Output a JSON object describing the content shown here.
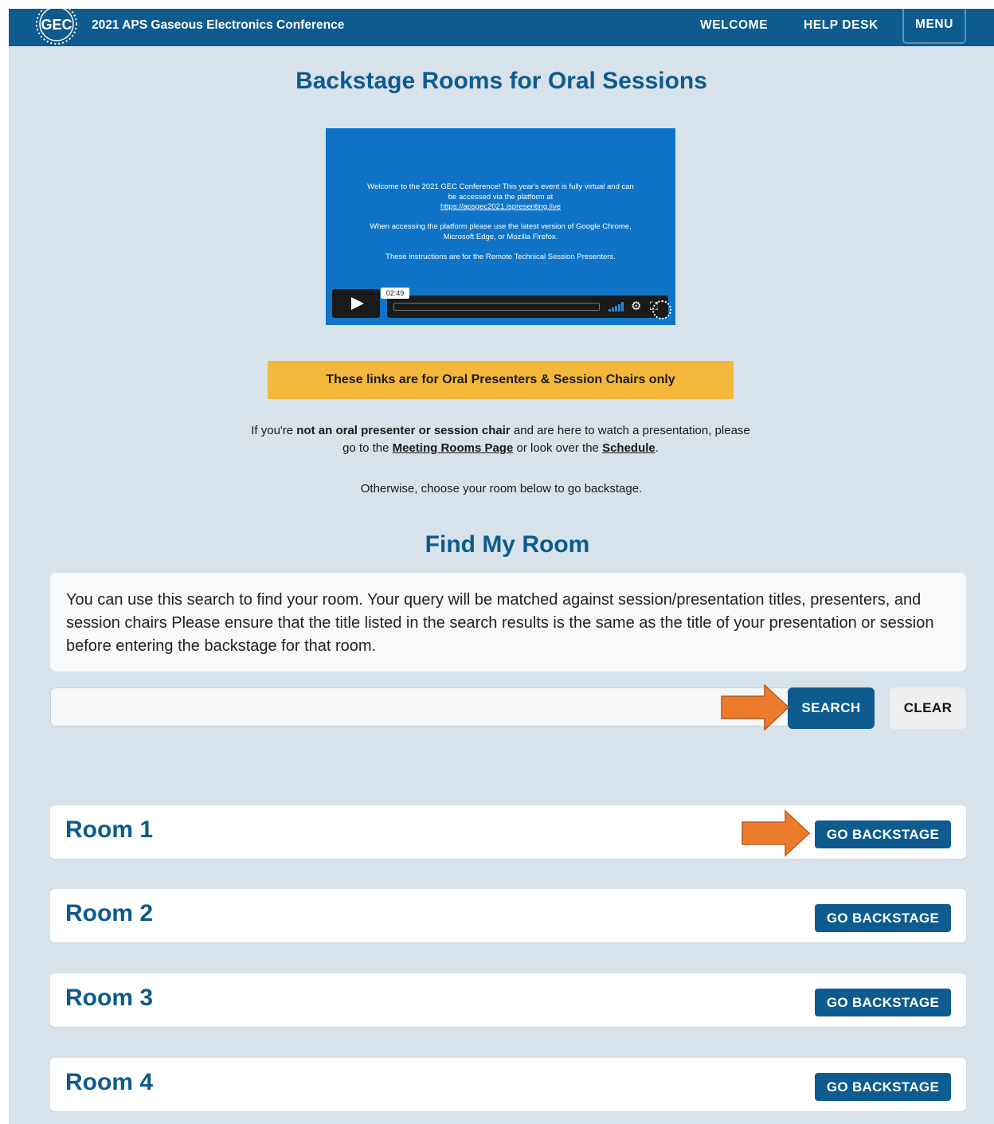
{
  "header": {
    "logo_text": "GEC",
    "site_title": "2021 APS Gaseous Electronics Conference",
    "nav": {
      "welcome": "WELCOME",
      "help_desk": "HELP DESK",
      "menu": "MENU"
    }
  },
  "page_title": "Backstage Rooms for Oral Sessions",
  "video": {
    "line1": "Welcome to the 2021 GEC Conference! This year's event is fully virtual and can be accessed via the platform at",
    "link": "https://apsgec2021.ispresenting.live",
    "line2": "When accessing the platform please use the latest version of Google Chrome, Microsoft Edge, or Mozilla Firefox.",
    "line3": "These instructions are for the Remote Technical Session Presenters.",
    "duration": "02:49"
  },
  "notice": "These links are for Oral Presenters & Session Chairs only",
  "info": {
    "part1": "If you're ",
    "bold": "not an oral presenter or session chair",
    "part2": " and are here to watch a presentation, please go to the ",
    "link1": "Meeting Rooms Page",
    "part3": " or look over the ",
    "link2": "Schedule",
    "part4": "."
  },
  "otherwise": "Otherwise, choose your room below to go backstage.",
  "find_title": "Find My Room",
  "search_help": "You can use this search to find your room. Your query will be matched against session/presentation titles, presenters, and session chairs Please ensure that the title listed in the search results is the same as the title of your presentation or session before entering the backstage for that room.",
  "search": {
    "value": "",
    "placeholder": "",
    "search_label": "SEARCH",
    "clear_label": "CLEAR"
  },
  "rooms": [
    {
      "name": "Room 1",
      "button": "GO BACKSTAGE"
    },
    {
      "name": "Room 2",
      "button": "GO BACKSTAGE"
    },
    {
      "name": "Room 3",
      "button": "GO BACKSTAGE"
    },
    {
      "name": "Room 4",
      "button": "GO BACKSTAGE"
    }
  ],
  "colors": {
    "brand": "#0d5b8f",
    "notice": "#f3b73b",
    "annotation_arrow": "#ec7c2c",
    "background": "#d8e2ea"
  }
}
